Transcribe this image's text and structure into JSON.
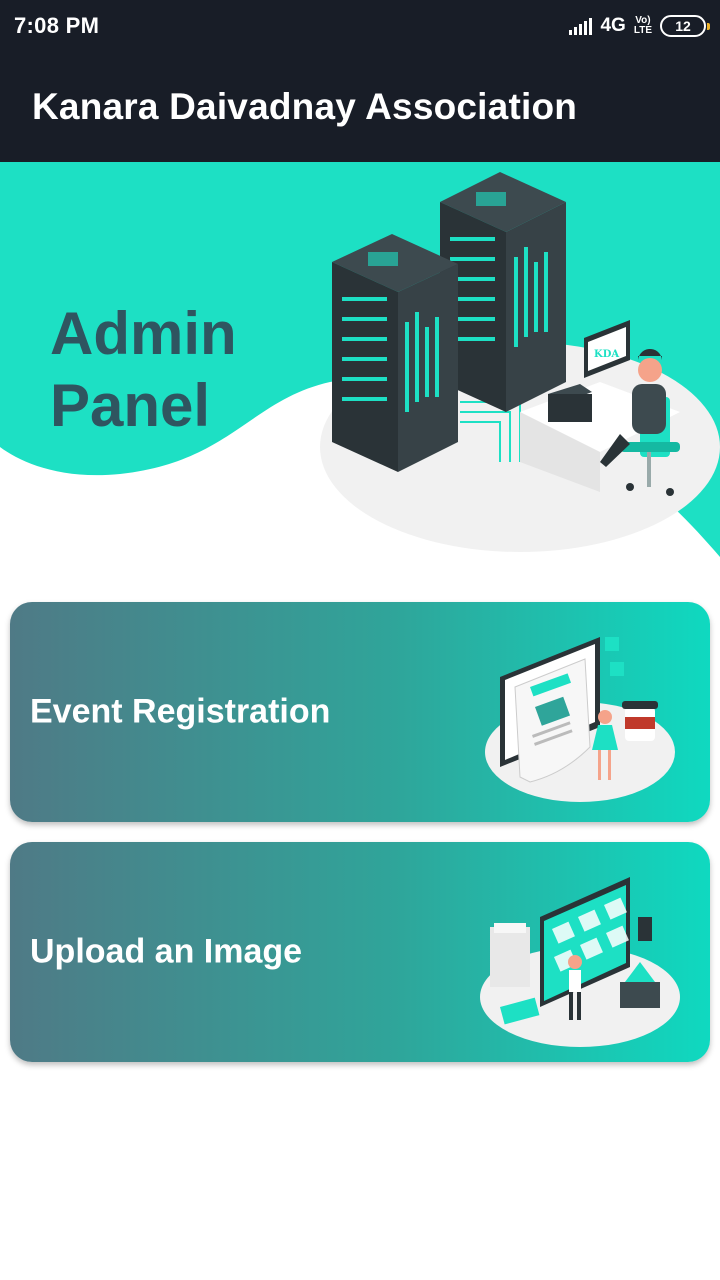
{
  "status_bar": {
    "time": "7:08 PM",
    "network": "4G",
    "volte_top": "Vo)",
    "volte_bottom": "LTE",
    "battery": "12"
  },
  "app_bar": {
    "title": "Kanara Daivadnay Association"
  },
  "hero": {
    "title_line1": "Admin",
    "title_line2": "Panel",
    "monitor_text": "KDA"
  },
  "cards": [
    {
      "label": "Event Registration",
      "icon": "event-registration-illustration"
    },
    {
      "label": "Upload an Image",
      "icon": "image-upload-illustration"
    }
  ],
  "colors": {
    "bar": "#181d27",
    "accent": "#1de0c4",
    "hero_text": "#2f5560",
    "card_start": "#4f7a86",
    "card_end": "#0fd9c0"
  }
}
